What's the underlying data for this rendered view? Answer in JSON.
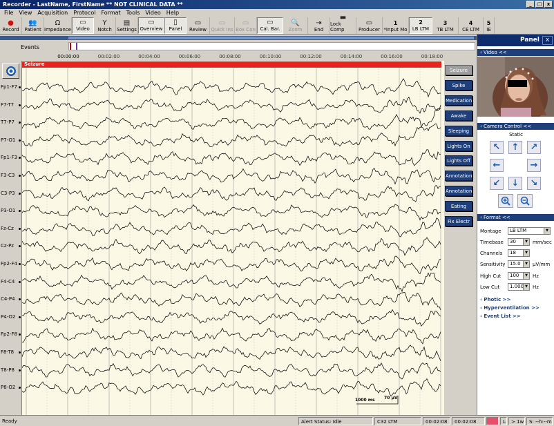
{
  "window": {
    "title": "Recorder - LastName, FirstName  ** NOT CLINICAL DATA **",
    "controls": [
      "_",
      "□",
      "x"
    ]
  },
  "menu": [
    "File",
    "View",
    "Acquisition",
    "Protocol",
    "Format",
    "Tools",
    "Video",
    "Help"
  ],
  "toolbar": [
    {
      "label": "Record",
      "icon": "record-icon",
      "glyph": "●",
      "color": "#d01010",
      "enabled": true
    },
    {
      "label": "Patient",
      "icon": "patient-icon",
      "glyph": "👥",
      "enabled": true
    },
    {
      "label": "Impedance",
      "icon": "impedance-icon",
      "glyph": "Ω",
      "enabled": true
    },
    {
      "label": "Video",
      "icon": "video-icon",
      "glyph": "▭",
      "enabled": true,
      "pressed": true
    },
    {
      "label": "Notch",
      "icon": "notch-icon",
      "glyph": "Y",
      "enabled": true
    },
    {
      "label": "Settings",
      "icon": "settings-icon",
      "glyph": "▤",
      "enabled": true
    },
    {
      "label": "Overview",
      "icon": "overview-icon",
      "glyph": "▭",
      "enabled": true,
      "pressed": true
    },
    {
      "label": "Panel",
      "icon": "panel-icon",
      "glyph": "▯",
      "enabled": true,
      "pressed": true
    },
    {
      "label": "Review",
      "icon": "review-icon",
      "glyph": "▭",
      "enabled": true
    },
    {
      "label": "Quick Ins",
      "icon": "quick-ins-icon",
      "glyph": "▭",
      "enabled": false
    },
    {
      "label": "Box Con",
      "icon": "box-con-icon",
      "glyph": "▭",
      "enabled": false
    },
    {
      "label": "Cal. Bar.",
      "icon": "cal-bar-icon",
      "glyph": "▭",
      "enabled": true,
      "pressed": true
    },
    {
      "label": "Zoom",
      "icon": "zoom-icon",
      "glyph": "🔍",
      "enabled": false
    },
    {
      "label": "End",
      "icon": "end-icon",
      "glyph": "⇥",
      "enabled": true
    },
    {
      "label": "Lock Comp",
      "icon": "lock-comp-icon",
      "glyph": "▬",
      "enabled": true
    },
    {
      "label": "Producer",
      "icon": "producer-icon",
      "glyph": "▭",
      "enabled": true
    },
    {
      "label": "*Input Mo",
      "number": "1",
      "enabled": true
    },
    {
      "label": "LB LTM",
      "number": "2",
      "enabled": true,
      "pressed": true
    },
    {
      "label": "TB LTM",
      "number": "3",
      "enabled": true
    },
    {
      "label": "CE LTM",
      "number": "4",
      "enabled": true
    },
    {
      "label": "IE",
      "number": "5",
      "enabled": true
    }
  ],
  "events_strip": {
    "label": "Events",
    "marks": [
      {
        "color": "#c00000"
      },
      {
        "color": "#7030a0"
      }
    ]
  },
  "time_axis": [
    "00:00:00",
    "00:02:00",
    "00:04:00",
    "00:06:00",
    "00:08:00",
    "00:10:00",
    "00:12:00",
    "00:14:00",
    "00:16:00",
    "00:18:00"
  ],
  "eeg": {
    "banner": "Seizure",
    "banner_color": "#e8221e",
    "channels": [
      "Fp1-F7",
      "F7-T7",
      "T7-P7",
      "P7-O1",
      "Fp1-F3",
      "F3-C3",
      "C3-P3",
      "P3-O1",
      "Fz-Cz",
      "Cz-Pz",
      "Fp2-F4",
      "F4-C4",
      "C4-P4",
      "P4-O2",
      "Fp2-F8",
      "F8-T8",
      "T8-P8",
      "P8-O2"
    ],
    "scale_bar": {
      "time": "1000 ms",
      "amplitude": "70 µV"
    }
  },
  "event_buttons": [
    "Seizure",
    "Spike",
    "Medication",
    "Awake",
    "Sleeping",
    "Lights On",
    "Lights Off",
    "Annotation",
    "Annotation",
    "Eating",
    "Fix Electr"
  ],
  "panel": {
    "title": "Panel",
    "close": "x",
    "video_section": "Video <<",
    "camera_section": "Camera Control <<",
    "camera_mode": "Static",
    "format_section": "Format <<",
    "format": {
      "montage_label": "Montage",
      "montage": "LB LTM",
      "timebase_label": "Timebase",
      "timebase": "30",
      "timebase_unit": "mm/sec",
      "channels_label": "Channels",
      "channels": "18",
      "sensitivity_label": "Sensitivity",
      "sensitivity": "15.0",
      "sensitivity_unit": "µV/mm",
      "highcut_label": "High Cut",
      "highcut": "100",
      "highcut_unit": "Hz",
      "lowcut_label": "Low Cut",
      "lowcut": "1.000",
      "lowcut_unit": "Hz"
    },
    "links": [
      "Photic >>",
      "Hyperventilation >>",
      "Event List >>"
    ]
  },
  "status": {
    "ready": "Ready",
    "alert": "Alert Status: Idle",
    "montage": "C32 LTM",
    "time1": "00:02:08",
    "time2": "00:02:08",
    "field_l": "L:",
    "rate": "> 1w",
    "field_s": "S: --h:--m"
  }
}
